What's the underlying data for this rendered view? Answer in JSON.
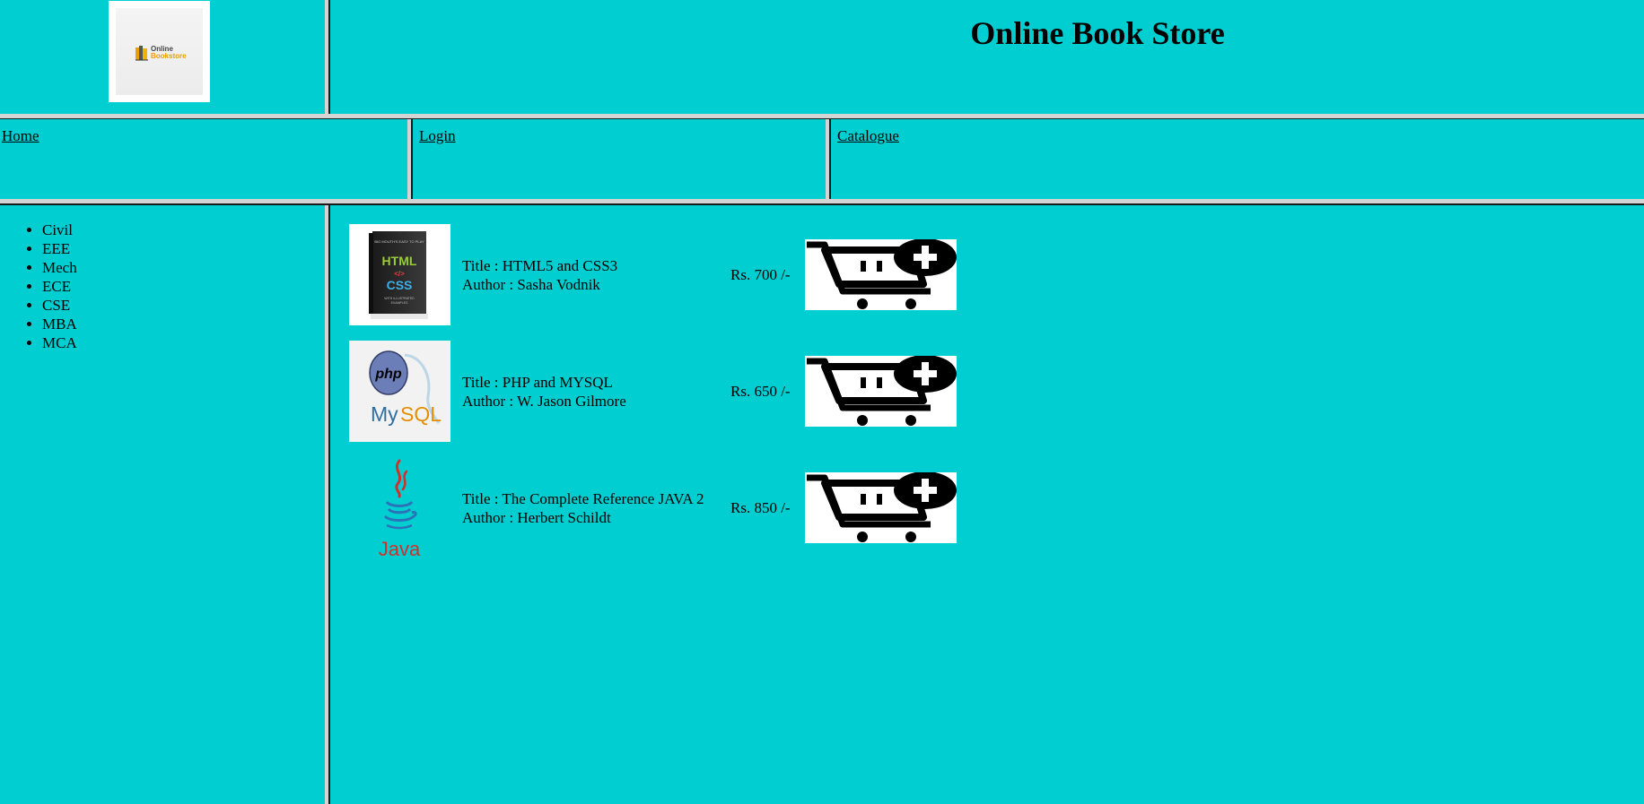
{
  "header": {
    "logo": {
      "line1": "Online",
      "line2": "Bookstore"
    },
    "title": "Online Book Store"
  },
  "nav": {
    "home": "Home",
    "login": "Login",
    "catalogue": "Catalogue"
  },
  "categories": [
    "Civil",
    "EEE",
    "Mech",
    "ECE",
    "CSE",
    "MBA",
    "MCA"
  ],
  "books": [
    {
      "title": "Title : HTML5 and CSS3",
      "author": "Author : Sasha Vodnik",
      "price": "Rs. 700 /-",
      "cover_icon": "html-css-book-cover"
    },
    {
      "title": "Title : PHP and MYSQL",
      "author": "Author : W. Jason Gilmore",
      "price": "Rs. 650 /-",
      "cover_icon": "php-mysql-logo"
    },
    {
      "title": "Title : The Complete Reference JAVA 2",
      "author": "Author : Herbert Schildt",
      "price": "Rs. 850 /-",
      "cover_icon": "java-logo"
    }
  ],
  "colors": {
    "background": "#00ced1",
    "separator": "#d4d4d4"
  }
}
